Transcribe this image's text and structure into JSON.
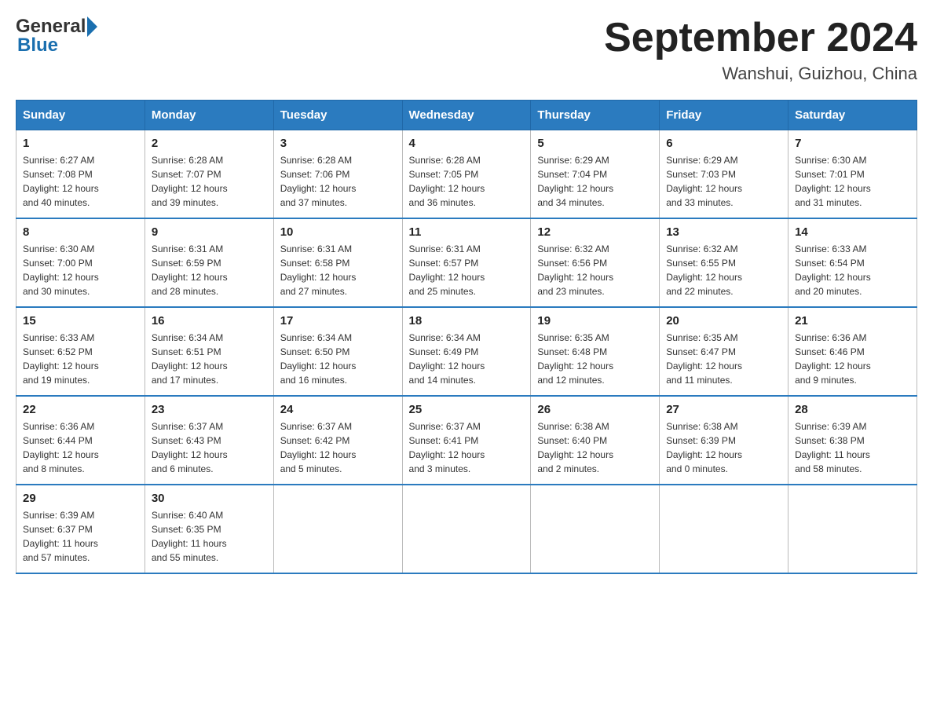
{
  "header": {
    "logo_general": "General",
    "logo_blue": "Blue",
    "month_title": "September 2024",
    "location": "Wanshui, Guizhou, China"
  },
  "weekdays": [
    "Sunday",
    "Monday",
    "Tuesday",
    "Wednesday",
    "Thursday",
    "Friday",
    "Saturday"
  ],
  "weeks": [
    [
      {
        "day": "1",
        "sunrise": "6:27 AM",
        "sunset": "7:08 PM",
        "daylight": "12 hours and 40 minutes."
      },
      {
        "day": "2",
        "sunrise": "6:28 AM",
        "sunset": "7:07 PM",
        "daylight": "12 hours and 39 minutes."
      },
      {
        "day": "3",
        "sunrise": "6:28 AM",
        "sunset": "7:06 PM",
        "daylight": "12 hours and 37 minutes."
      },
      {
        "day": "4",
        "sunrise": "6:28 AM",
        "sunset": "7:05 PM",
        "daylight": "12 hours and 36 minutes."
      },
      {
        "day": "5",
        "sunrise": "6:29 AM",
        "sunset": "7:04 PM",
        "daylight": "12 hours and 34 minutes."
      },
      {
        "day": "6",
        "sunrise": "6:29 AM",
        "sunset": "7:03 PM",
        "daylight": "12 hours and 33 minutes."
      },
      {
        "day": "7",
        "sunrise": "6:30 AM",
        "sunset": "7:01 PM",
        "daylight": "12 hours and 31 minutes."
      }
    ],
    [
      {
        "day": "8",
        "sunrise": "6:30 AM",
        "sunset": "7:00 PM",
        "daylight": "12 hours and 30 minutes."
      },
      {
        "day": "9",
        "sunrise": "6:31 AM",
        "sunset": "6:59 PM",
        "daylight": "12 hours and 28 minutes."
      },
      {
        "day": "10",
        "sunrise": "6:31 AM",
        "sunset": "6:58 PM",
        "daylight": "12 hours and 27 minutes."
      },
      {
        "day": "11",
        "sunrise": "6:31 AM",
        "sunset": "6:57 PM",
        "daylight": "12 hours and 25 minutes."
      },
      {
        "day": "12",
        "sunrise": "6:32 AM",
        "sunset": "6:56 PM",
        "daylight": "12 hours and 23 minutes."
      },
      {
        "day": "13",
        "sunrise": "6:32 AM",
        "sunset": "6:55 PM",
        "daylight": "12 hours and 22 minutes."
      },
      {
        "day": "14",
        "sunrise": "6:33 AM",
        "sunset": "6:54 PM",
        "daylight": "12 hours and 20 minutes."
      }
    ],
    [
      {
        "day": "15",
        "sunrise": "6:33 AM",
        "sunset": "6:52 PM",
        "daylight": "12 hours and 19 minutes."
      },
      {
        "day": "16",
        "sunrise": "6:34 AM",
        "sunset": "6:51 PM",
        "daylight": "12 hours and 17 minutes."
      },
      {
        "day": "17",
        "sunrise": "6:34 AM",
        "sunset": "6:50 PM",
        "daylight": "12 hours and 16 minutes."
      },
      {
        "day": "18",
        "sunrise": "6:34 AM",
        "sunset": "6:49 PM",
        "daylight": "12 hours and 14 minutes."
      },
      {
        "day": "19",
        "sunrise": "6:35 AM",
        "sunset": "6:48 PM",
        "daylight": "12 hours and 12 minutes."
      },
      {
        "day": "20",
        "sunrise": "6:35 AM",
        "sunset": "6:47 PM",
        "daylight": "12 hours and 11 minutes."
      },
      {
        "day": "21",
        "sunrise": "6:36 AM",
        "sunset": "6:46 PM",
        "daylight": "12 hours and 9 minutes."
      }
    ],
    [
      {
        "day": "22",
        "sunrise": "6:36 AM",
        "sunset": "6:44 PM",
        "daylight": "12 hours and 8 minutes."
      },
      {
        "day": "23",
        "sunrise": "6:37 AM",
        "sunset": "6:43 PM",
        "daylight": "12 hours and 6 minutes."
      },
      {
        "day": "24",
        "sunrise": "6:37 AM",
        "sunset": "6:42 PM",
        "daylight": "12 hours and 5 minutes."
      },
      {
        "day": "25",
        "sunrise": "6:37 AM",
        "sunset": "6:41 PM",
        "daylight": "12 hours and 3 minutes."
      },
      {
        "day": "26",
        "sunrise": "6:38 AM",
        "sunset": "6:40 PM",
        "daylight": "12 hours and 2 minutes."
      },
      {
        "day": "27",
        "sunrise": "6:38 AM",
        "sunset": "6:39 PM",
        "daylight": "12 hours and 0 minutes."
      },
      {
        "day": "28",
        "sunrise": "6:39 AM",
        "sunset": "6:38 PM",
        "daylight": "11 hours and 58 minutes."
      }
    ],
    [
      {
        "day": "29",
        "sunrise": "6:39 AM",
        "sunset": "6:37 PM",
        "daylight": "11 hours and 57 minutes."
      },
      {
        "day": "30",
        "sunrise": "6:40 AM",
        "sunset": "6:35 PM",
        "daylight": "11 hours and 55 minutes."
      },
      null,
      null,
      null,
      null,
      null
    ]
  ],
  "labels": {
    "sunrise": "Sunrise:",
    "sunset": "Sunset:",
    "daylight": "Daylight:"
  }
}
